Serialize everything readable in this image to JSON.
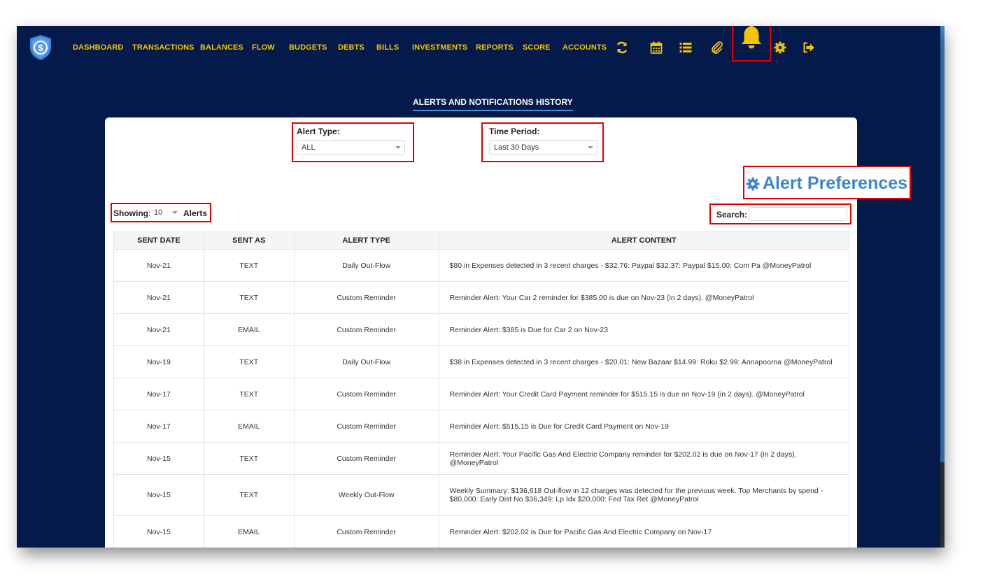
{
  "nav": {
    "links": [
      "DASHBOARD",
      "TRANSACTIONS",
      "BALANCES",
      "FLOW",
      "BUDGETS",
      "DEBTS",
      "BILLS",
      "INVESTMENTS",
      "REPORTS",
      "SCORE",
      "ACCOUNTS"
    ],
    "icons": [
      "refresh-icon",
      "calendar-icon",
      "list-icon",
      "paperclip-icon",
      "bell-icon",
      "gear-icon",
      "logout-icon"
    ],
    "accent_color": "#f5c400"
  },
  "page": {
    "title": "ALERTS AND NOTIFICATIONS HISTORY"
  },
  "filters": {
    "alert_type": {
      "label": "Alert Type:",
      "value": "ALL"
    },
    "time_period": {
      "label": "Time Period:",
      "value": "Last 30 Days"
    }
  },
  "prefs": {
    "label": "Alert Preferences"
  },
  "showing": {
    "prefix": "Showing:",
    "value": "10",
    "suffix": "Alerts"
  },
  "search": {
    "label": "Search:",
    "value": ""
  },
  "table": {
    "headers": [
      "SENT DATE",
      "SENT AS",
      "ALERT TYPE",
      "ALERT CONTENT"
    ],
    "rows": [
      {
        "date": "Nov-21",
        "sent_as": "TEXT",
        "type": "Daily Out-Flow",
        "content": "$80 in Expenses detected in 3 recent charges - $32.76: Paypal $32.37: Paypal $15.00: Com Pa @MoneyPatrol"
      },
      {
        "date": "Nov-21",
        "sent_as": "TEXT",
        "type": "Custom Reminder",
        "content": "Reminder Alert: Your Car 2 reminder for $385.00 is due on Nov-23 (in 2 days). @MoneyPatrol"
      },
      {
        "date": "Nov-21",
        "sent_as": "EMAIL",
        "type": "Custom Reminder",
        "content": "Reminder Alert: $385 is Due for Car 2 on Nov-23"
      },
      {
        "date": "Nov-19",
        "sent_as": "TEXT",
        "type": "Daily Out-Flow",
        "content": "$38 in Expenses detected in 3 recent charges - $20.01: New Bazaar $14.99: Roku $2.99: Annapoorna @MoneyPatrol"
      },
      {
        "date": "Nov-17",
        "sent_as": "TEXT",
        "type": "Custom Reminder",
        "content": "Reminder Alert: Your Credit Card Payment reminder for $515.15 is due on Nov-19 (in 2 days). @MoneyPatrol"
      },
      {
        "date": "Nov-17",
        "sent_as": "EMAIL",
        "type": "Custom Reminder",
        "content": "Reminder Alert: $515.15 is Due for Credit Card Payment on Nov-19"
      },
      {
        "date": "Nov-15",
        "sent_as": "TEXT",
        "type": "Custom Reminder",
        "content": "Reminder Alert: Your Pacific Gas And Electric Company reminder for $202.02 is due on Nov-17 (in 2 days). @MoneyPatrol"
      },
      {
        "date": "Nov-15",
        "sent_as": "TEXT",
        "type": "Weekly Out-Flow",
        "content": "Weekly Summary: $136,618 Out-flow in 12 charges was detected for the previous week. Top Merchants by spend - $80,000: Early Dist No $36,349: Lp Idx $20,000: Fed Tax Ret @MoneyPatrol"
      },
      {
        "date": "Nov-15",
        "sent_as": "EMAIL",
        "type": "Custom Reminder",
        "content": "Reminder Alert: $202.02 is Due for Pacific Gas And Electric Company on Nov-17"
      },
      {
        "date": "",
        "sent_as": "",
        "type": "",
        "content": ""
      }
    ]
  }
}
